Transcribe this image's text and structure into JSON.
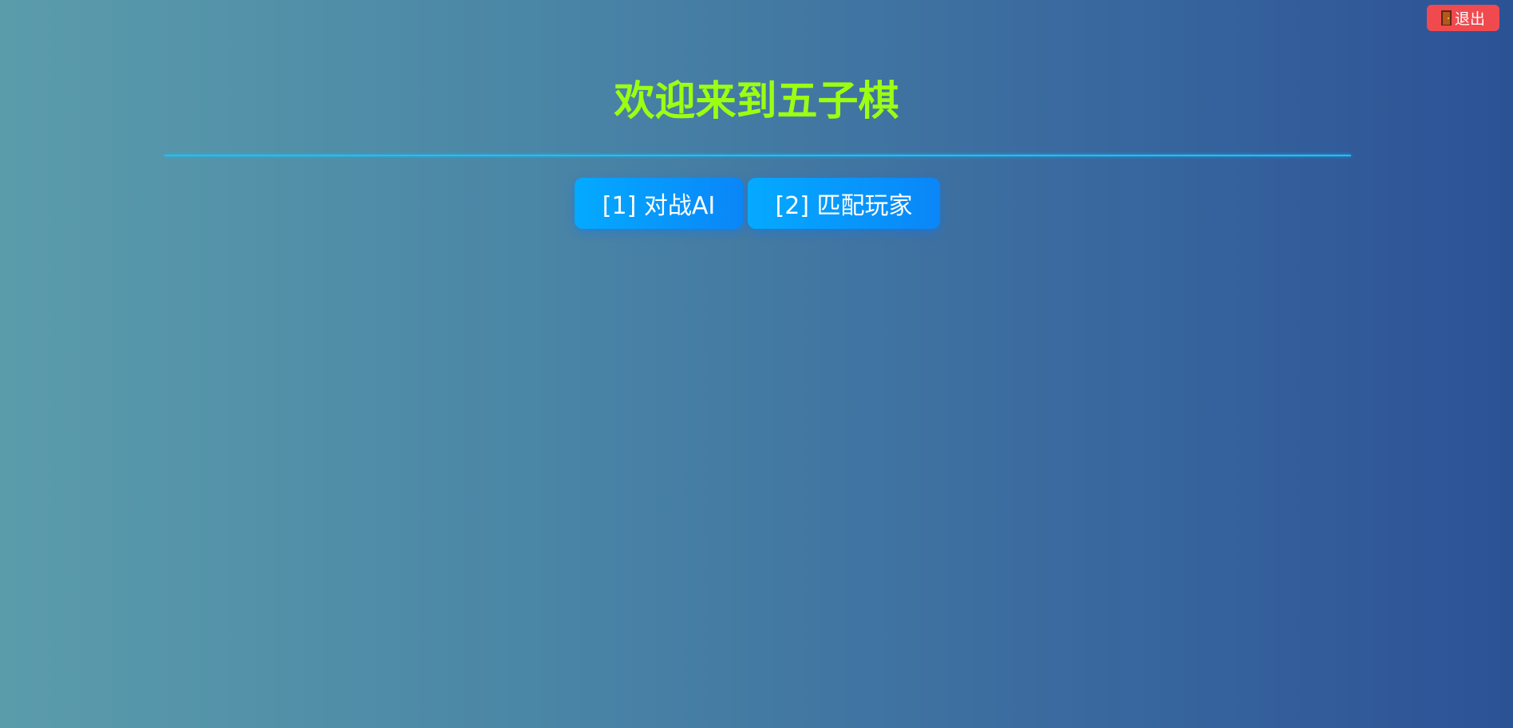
{
  "header": {
    "exit_label": "退出",
    "exit_icon": "door-icon",
    "exit_color": "#f04a4f"
  },
  "main": {
    "title": "欢迎来到五子棋",
    "title_color": "#9cff12",
    "divider_color": "#14c6ff",
    "modes": [
      {
        "label": "[1] 对战AI"
      },
      {
        "label": "[2] 匹配玩家"
      }
    ]
  }
}
